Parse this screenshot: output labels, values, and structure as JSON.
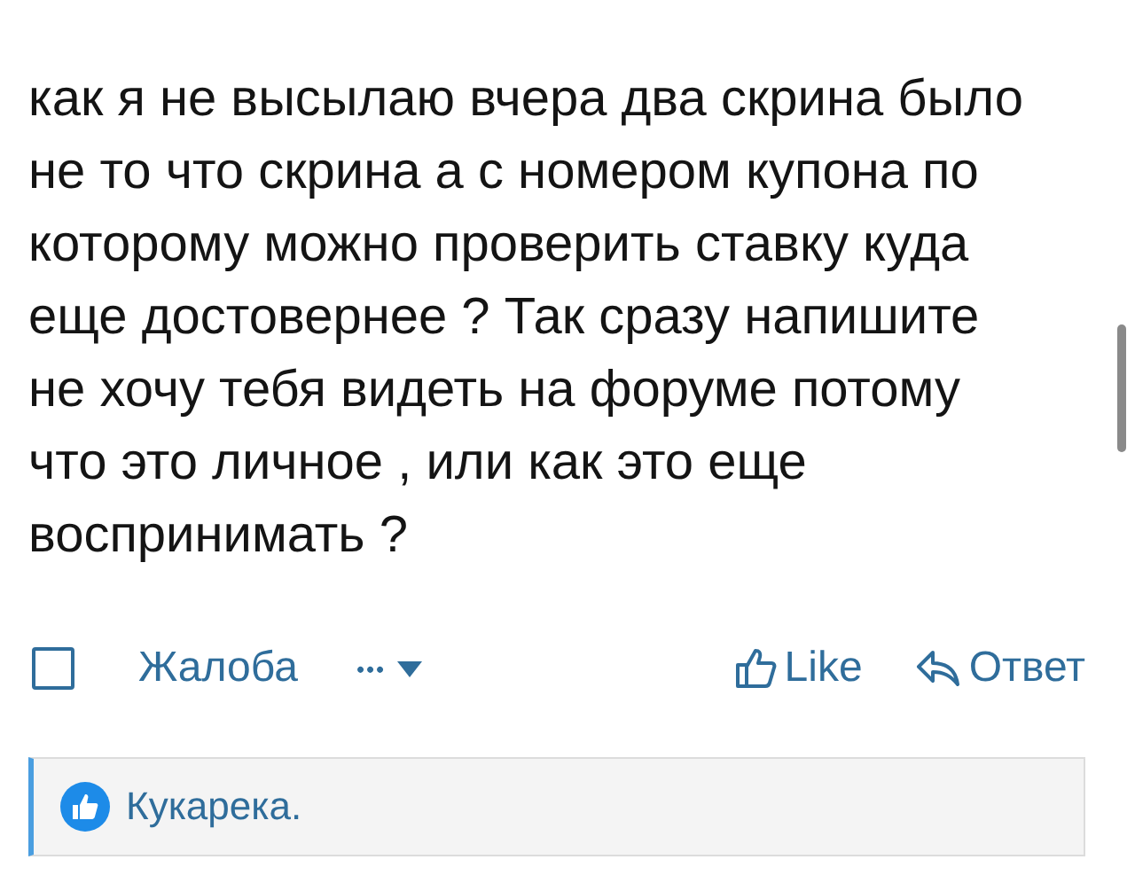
{
  "post": {
    "lines": [
      "как я не высылаю вчера два скрина было",
      "не то что скрина а с номером купона по",
      "которому можно проверить ставку куда",
      "еще достовернее ? Так сразу напишите",
      "не хочу тебя видеть на форуме потому",
      "что это личное , или как это еще",
      "воспринимать ?"
    ]
  },
  "actions": {
    "select": {
      "checked": false
    },
    "report": "Жалоба",
    "more": "•••",
    "like": "Like",
    "reply": "Ответ"
  },
  "reactions": {
    "text": "Кукарека."
  }
}
